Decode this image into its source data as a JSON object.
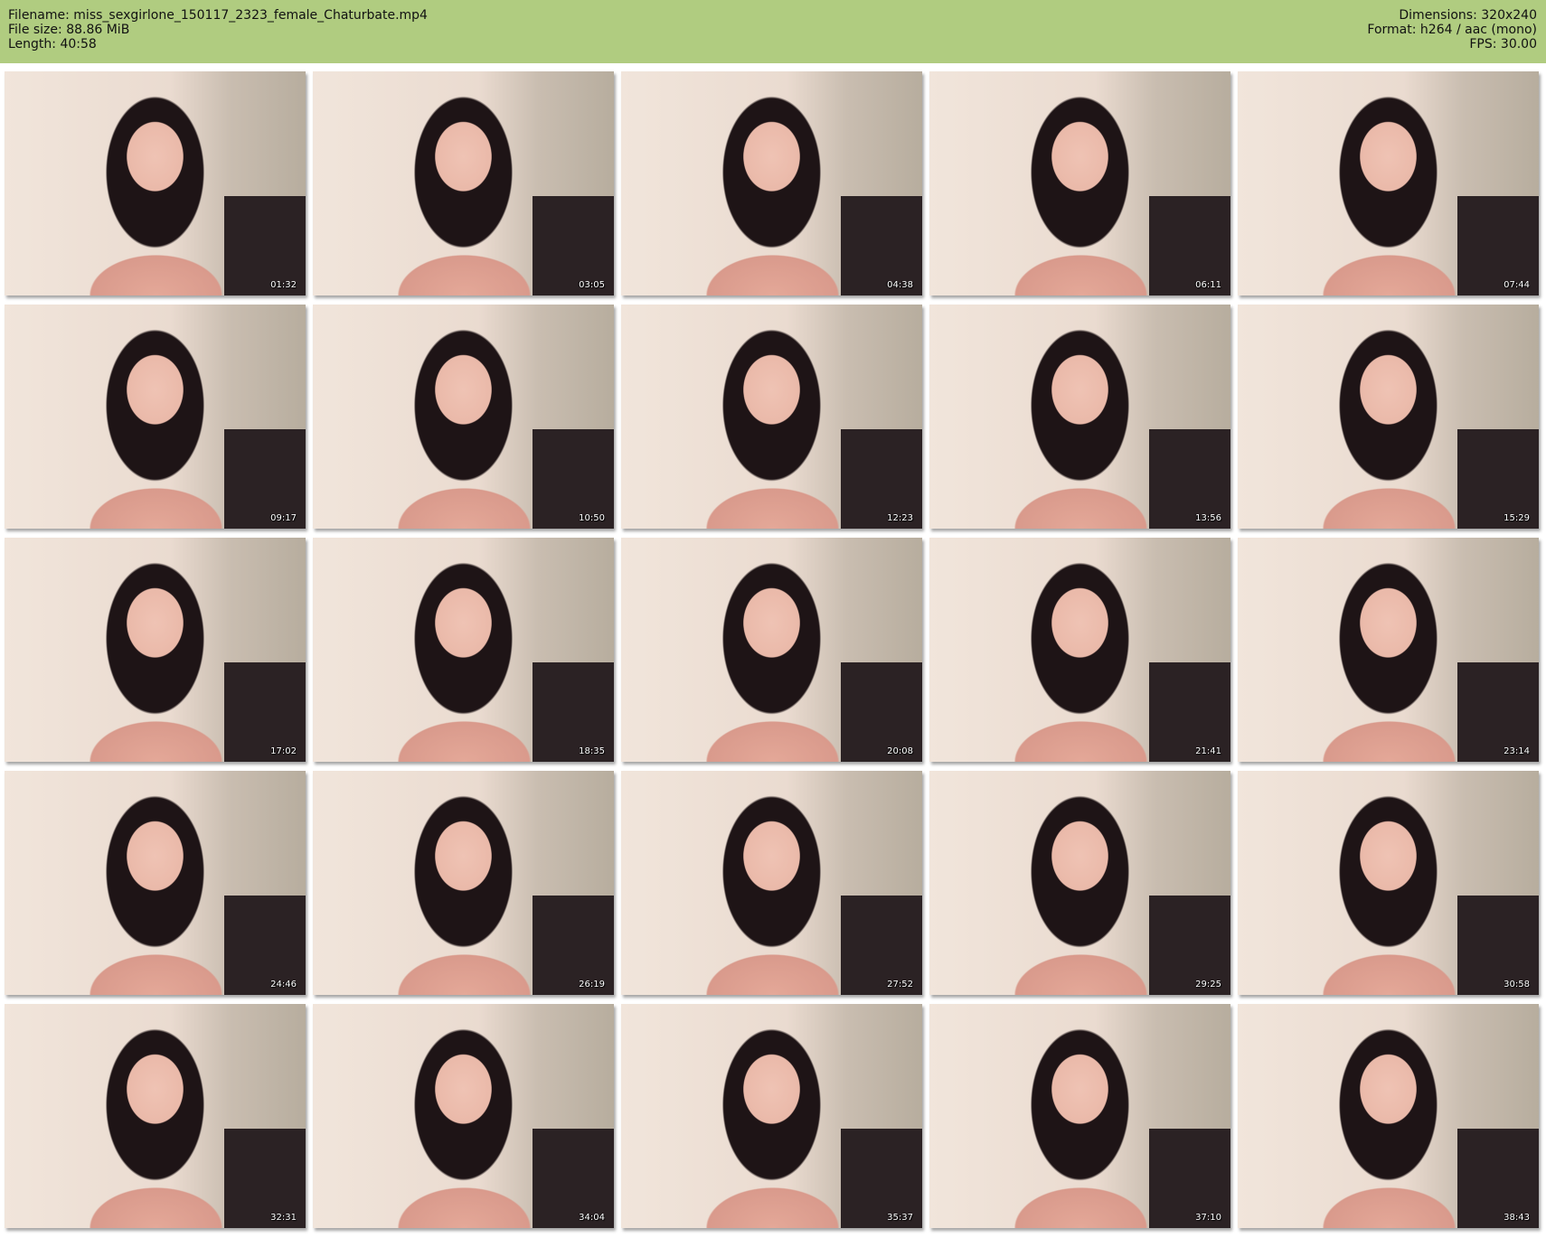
{
  "header": {
    "filename": "Filename: miss_sexgirlone_150117_2323_female_Chaturbate.mp4",
    "filesize": "File size: 88.86 MiB",
    "length": "Length: 40:58",
    "dimensions": "Dimensions: 320x240",
    "format": "Format: h264 / aac (mono)",
    "fps": "FPS: 30.00"
  },
  "colors": {
    "header_bg": "#b0cc80"
  },
  "thumbnails": [
    {
      "timestamp": "01:32"
    },
    {
      "timestamp": "03:05"
    },
    {
      "timestamp": "04:38"
    },
    {
      "timestamp": "06:11"
    },
    {
      "timestamp": "07:44"
    },
    {
      "timestamp": "09:17"
    },
    {
      "timestamp": "10:50"
    },
    {
      "timestamp": "12:23"
    },
    {
      "timestamp": "13:56"
    },
    {
      "timestamp": "15:29"
    },
    {
      "timestamp": "17:02"
    },
    {
      "timestamp": "18:35"
    },
    {
      "timestamp": "20:08"
    },
    {
      "timestamp": "21:41"
    },
    {
      "timestamp": "23:14"
    },
    {
      "timestamp": "24:46"
    },
    {
      "timestamp": "26:19"
    },
    {
      "timestamp": "27:52"
    },
    {
      "timestamp": "29:25"
    },
    {
      "timestamp": "30:58"
    },
    {
      "timestamp": "32:31"
    },
    {
      "timestamp": "34:04"
    },
    {
      "timestamp": "35:37"
    },
    {
      "timestamp": "37:10"
    },
    {
      "timestamp": "38:43"
    }
  ]
}
